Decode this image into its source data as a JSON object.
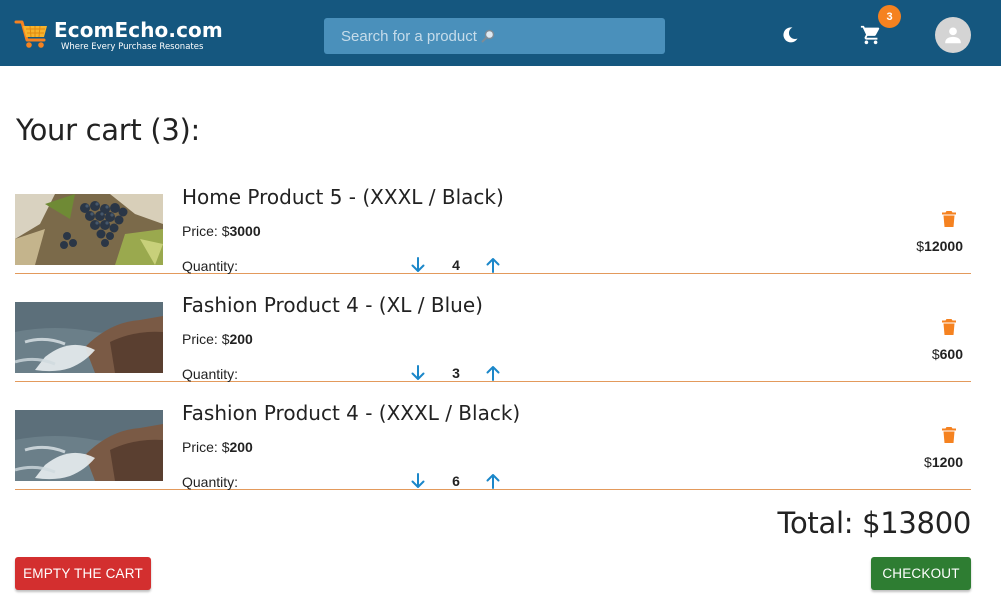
{
  "header": {
    "brand": "EcomEcho.com",
    "tagline": "Where Every Purchase Resonates",
    "search_placeholder": "Search for a product",
    "cart_count": "3"
  },
  "cart": {
    "title": "Your cart (3):",
    "price_label": "Price: ",
    "quantity_label": "Quantity:",
    "currency": "$",
    "items": [
      {
        "name": "Home Product 5 - (XXXL / Black)",
        "price": "3000",
        "quantity": "4",
        "subtotal": "12000",
        "image": "grapes-photo"
      },
      {
        "name": "Fashion Product 4 - (XL / Blue)",
        "price": "200",
        "quantity": "3",
        "subtotal": "600",
        "image": "sea-rocks-photo"
      },
      {
        "name": "Fashion Product 4 - (XXXL / Black)",
        "price": "200",
        "quantity": "6",
        "subtotal": "1200",
        "image": "sea-rocks-photo"
      }
    ],
    "total_label": "Total: $13800",
    "empty_button": "EMPTY THE CART",
    "checkout_button": "CHECKOUT"
  },
  "colors": {
    "appbar": "#15577f",
    "accent_orange": "#f58220",
    "arrow_blue": "#1b87c9",
    "empty_red": "#d32f2f",
    "checkout_green": "#2e7d32",
    "divider": "#e39a5c"
  }
}
